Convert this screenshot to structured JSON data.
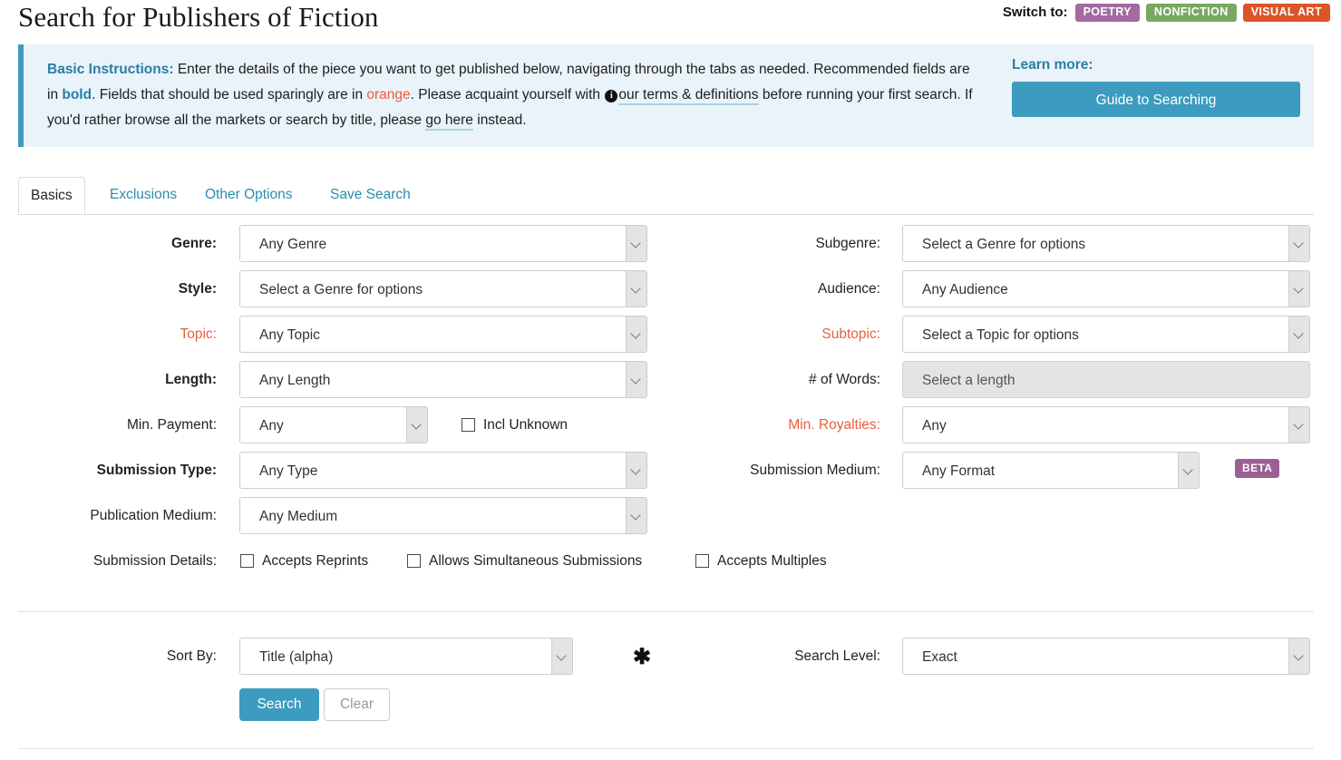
{
  "header": {
    "title": "Search for Publishers of Fiction",
    "switch_label": "Switch to:",
    "badges": [
      {
        "label": "POETRY",
        "color": "#a26ba1"
      },
      {
        "label": "NONFICTION",
        "color": "#79a860"
      },
      {
        "label": "VISUAL ART",
        "color": "#dd5427"
      }
    ]
  },
  "alert": {
    "lead": "Basic Instructions:",
    "t1": " Enter the details of the piece you want to get published below, navigating through the tabs as needed. Recommended fields are in ",
    "bold_word": "bold",
    "t2": ". Fields that should be used sparingly are in ",
    "orange_word": "orange",
    "t3": ". Please acquaint yourself with ",
    "info_icon": "info-icon",
    "terms_link": "our terms & definitions",
    "t4": " before running your first search. If you'd rather browse all the markets or search by title, please ",
    "go_here_link": "go here",
    "t5": " instead.",
    "learn_more_label": "Learn more:",
    "guide_button": "Guide to Searching"
  },
  "tabs": [
    {
      "label": "Basics",
      "active": true
    },
    {
      "label": "Exclusions",
      "active": false
    },
    {
      "label": "Other Options",
      "active": false
    },
    {
      "label": "Save Search",
      "active": false
    }
  ],
  "fields": {
    "genre": {
      "label": "Genre:",
      "value": "Any Genre"
    },
    "subgenre": {
      "label": "Subgenre:",
      "value": "Select a Genre for options"
    },
    "style": {
      "label": "Style:",
      "value": "Select a Genre for options"
    },
    "audience": {
      "label": "Audience:",
      "value": "Any Audience"
    },
    "topic": {
      "label": "Topic:",
      "value": "Any Topic"
    },
    "subtopic": {
      "label": "Subtopic:",
      "value": "Select a Topic for options"
    },
    "length": {
      "label": "Length:",
      "value": "Any Length"
    },
    "num_words": {
      "label": "# of Words:",
      "placeholder": "Select a length"
    },
    "min_payment": {
      "label": "Min. Payment:",
      "value": "Any"
    },
    "incl_unknown": {
      "label": "Incl Unknown",
      "checked": false
    },
    "min_royalties": {
      "label": "Min. Royalties:",
      "value": "Any"
    },
    "submission_type": {
      "label": "Submission Type:",
      "value": "Any Type"
    },
    "submission_medium": {
      "label": "Submission Medium:",
      "value": "Any Format",
      "badge": "BETA"
    },
    "publication_medium": {
      "label": "Publication Medium:",
      "value": "Any Medium"
    },
    "submission_details": {
      "label": "Submission Details:",
      "options": [
        {
          "label": "Accepts Reprints",
          "checked": false
        },
        {
          "label": "Allows Simultaneous Submissions",
          "checked": false
        },
        {
          "label": "Accepts Multiples",
          "checked": false
        }
      ]
    },
    "sort_by": {
      "label": "Sort By:",
      "value": "Title (alpha)"
    },
    "search_level": {
      "label": "Search Level:",
      "value": "Exact"
    },
    "asterisk": "✱"
  },
  "actions": {
    "search": "Search",
    "clear": "Clear"
  }
}
